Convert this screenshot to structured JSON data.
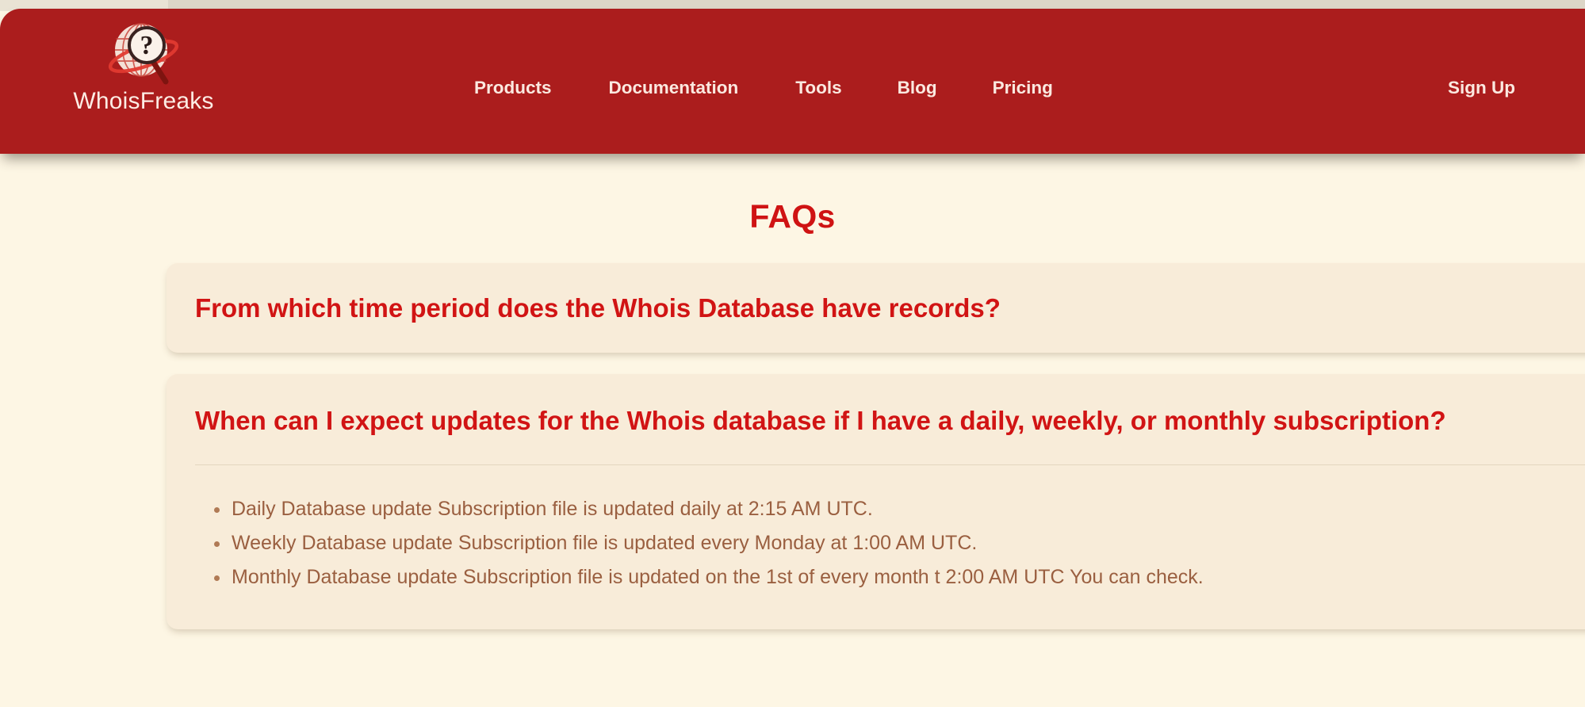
{
  "brand": {
    "name": "WhoisFreaks",
    "logo_icon": "globe-magnifier-question-icon",
    "colors": {
      "header_bg": "#ab1d1d",
      "logo_accent": "#d62828"
    }
  },
  "header": {
    "nav": [
      {
        "label": "Products",
        "name": "nav-link-products"
      },
      {
        "label": "Documentation",
        "name": "nav-link-documentation"
      },
      {
        "label": "Tools",
        "name": "nav-link-tools"
      },
      {
        "label": "Blog",
        "name": "nav-link-blog"
      },
      {
        "label": "Pricing",
        "name": "nav-link-pricing"
      }
    ],
    "signup_label": "Sign Up"
  },
  "main": {
    "title": "FAQs",
    "title_color": "#cf1313",
    "page_bg": "#fdf6e4",
    "card_bg": "#f8ecd9",
    "faqs": [
      {
        "question": "From which time period does the Whois Database have records?",
        "expanded": false,
        "answer_bullets": []
      },
      {
        "question": "When can I expect updates for the Whois database if I have a daily, weekly, or monthly subscription?",
        "expanded": true,
        "answer_bullets": [
          "Daily Database update Subscription file is updated daily at 2:15 AM UTC.",
          "Weekly Database update Subscription file is updated every Monday at 1:00 AM UTC.",
          "Monthly Database update Subscription file is updated on the 1st of every month t 2:00 AM UTC You can check."
        ]
      }
    ]
  }
}
